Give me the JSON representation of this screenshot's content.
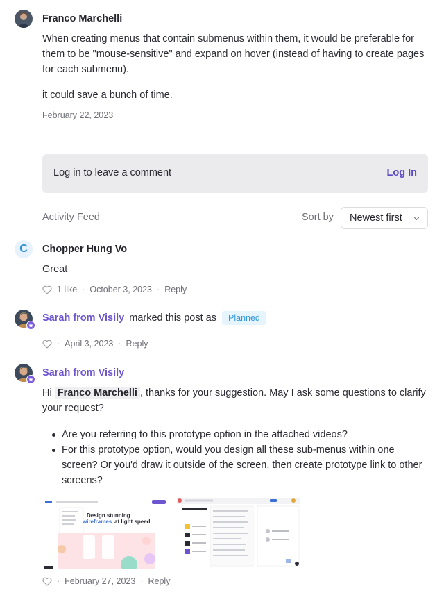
{
  "post": {
    "author": "Franco Marchelli",
    "body_1": "When creating menus that contain submenus within them, it would be preferable for them to be \"mouse-sensitive\" and expand on hover (instead of having to create pages for each submenu).",
    "body_2": "it could save a bunch of time.",
    "date": "February 22, 2023"
  },
  "login": {
    "message": "Log in to leave a comment",
    "link": "Log In"
  },
  "feed": {
    "title": "Activity Feed",
    "sort_label": "Sort by",
    "sort_value": "Newest first"
  },
  "comments": [
    {
      "avatar_letter": "C",
      "author": "Chopper Hung Vo",
      "body": "Great",
      "likes": "1 like",
      "date": "October 3, 2023",
      "reply": "Reply"
    },
    {
      "author": "Sarah from Visily",
      "action": "marked this post as",
      "status": "Planned",
      "date": "April 3, 2023",
      "reply": "Reply"
    },
    {
      "author": "Sarah from Visily",
      "greeting": "Hi",
      "mention": "Franco Marchelli",
      "body_rest": ", thanks for your suggestion. May I ask some questions to clarify your request?",
      "questions": [
        "Are you referring to this prototype option in the attached videos?",
        "For this prototype option, would you design all these sub-menus within one screen? Or you'd draw it outside of the screen, then create prototype link to other screens?"
      ],
      "date": "February 27, 2023",
      "reply": "Reply"
    }
  ],
  "colors": {
    "accent_purple": "#6d55cf",
    "planned_bg": "#e6f4fd",
    "planned_text": "#2f97d8",
    "login_bg": "#ebebed"
  }
}
